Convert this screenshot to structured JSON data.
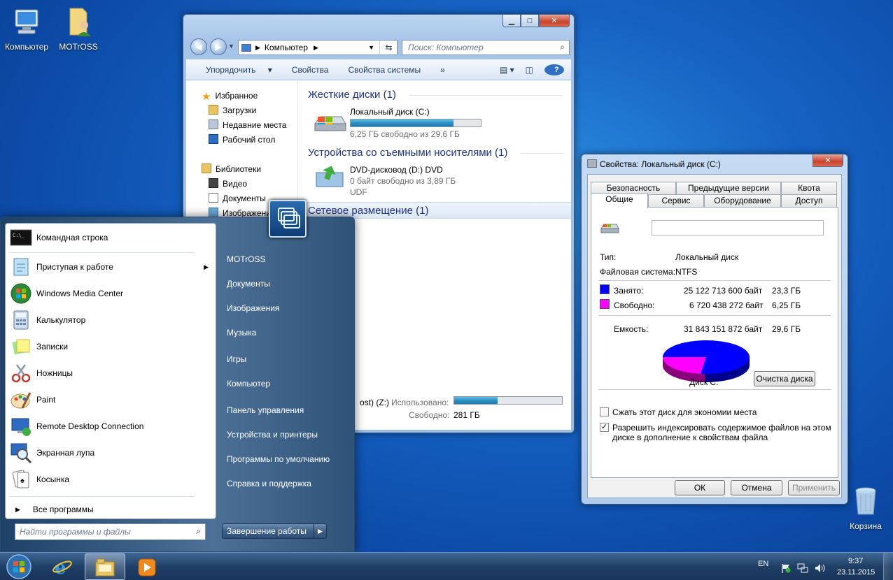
{
  "desktop": {
    "icons": [
      {
        "label": "Компьютер",
        "icon": "computer-icon"
      },
      {
        "label": "MOTrOSS",
        "icon": "user-folder-icon"
      },
      {
        "label": "Корзина",
        "icon": "recycle-bin-icon"
      }
    ]
  },
  "explorer": {
    "address": "Компьютер",
    "search_placeholder": "Поиск: Компьютер",
    "toolbar": {
      "organize": "Упорядочить",
      "properties": "Свойства",
      "system_properties": "Свойства системы",
      "more": "»"
    },
    "nav": {
      "favorites": "Избранное",
      "downloads": "Загрузки",
      "recent": "Недавние места",
      "desktop": "Рабочий стол",
      "libraries": "Библиотеки",
      "video": "Видео",
      "documents": "Документы",
      "images": "Изображения"
    },
    "groups": {
      "hard_disks": "Жесткие диски (1)",
      "removable": "Устройства со съемными носителями (1)",
      "network": "Сетевое размещение (1)"
    },
    "drive_c": {
      "name": "Локальный диск (C:)",
      "free_text": "6,25 ГБ свободно из 29,6 ГБ",
      "used_fraction": 0.79
    },
    "dvd": {
      "name": "DVD-дисковод (D:) DVD",
      "free_text": "0 байт свободно из 3,89 ГБ",
      "fs": "UDF"
    },
    "network_drive": {
      "name_tail": "ost) (Z:)",
      "used_label": "Использовано:",
      "free_label": "Свободно:",
      "free_value": "281 ГБ",
      "used_fraction": 0.4
    }
  },
  "properties": {
    "title": "Свойства: Локальный диск (C:)",
    "tabs_back": [
      "Безопасность",
      "Предыдущие версии",
      "Квота"
    ],
    "tabs_front": [
      "Общие",
      "Сервис",
      "Оборудование",
      "Доступ"
    ],
    "type_label": "Тип:",
    "type_value": "Локальный диск",
    "fs_label": "Файловая система:",
    "fs_value": "NTFS",
    "used_label": "Занято:",
    "used_bytes": "25 122 713 600 байт",
    "used_gb": "23,3 ГБ",
    "free_label": "Свободно:",
    "free_bytes": "6 720 438 272 байт",
    "free_gb": "6,25 ГБ",
    "capacity_label": "Емкость:",
    "capacity_bytes": "31 843 151 872 байт",
    "capacity_gb": "29,6 ГБ",
    "disk_label": "Диск C:",
    "cleanup_btn": "Очистка диска",
    "compress_label": "Сжать этот диск для экономии места",
    "index_label_1": "Разрешить индексировать содержимое файлов на этом",
    "index_label_2": "диске в дополнение к свойствам файла",
    "ok": "ОК",
    "cancel": "Отмена",
    "apply": "Применить",
    "colors": {
      "used": "#0000ff",
      "free": "#ff00ff"
    }
  },
  "startmenu": {
    "programs": [
      {
        "label": "Командная строка",
        "icon": "cmd-icon"
      },
      {
        "label": "Приступая к работе",
        "icon": "getting-started-icon"
      },
      {
        "label": "Windows Media Center",
        "icon": "media-center-icon"
      },
      {
        "label": "Калькулятор",
        "icon": "calculator-icon"
      },
      {
        "label": "Записки",
        "icon": "sticky-notes-icon"
      },
      {
        "label": "Ножницы",
        "icon": "scissors-icon"
      },
      {
        "label": "Paint",
        "icon": "paint-icon"
      },
      {
        "label": "Remote Desktop Connection",
        "icon": "remote-desktop-icon"
      },
      {
        "label": "Экранная лупа",
        "icon": "magnifier-icon"
      },
      {
        "label": "Косынка",
        "icon": "solitaire-icon"
      }
    ],
    "all_programs": "Все программы",
    "search_placeholder": "Найти программы и файлы",
    "right": [
      "MOTrOSS",
      "Документы",
      "Изображения",
      "Музыка",
      "Игры",
      "Компьютер",
      "Панель управления",
      "Устройства и принтеры",
      "Программы по умолчанию",
      "Справка и поддержка"
    ],
    "shutdown": "Завершение работы"
  },
  "taskbar": {
    "lang": "EN",
    "time": "9:37",
    "date": "23.11.2015"
  }
}
